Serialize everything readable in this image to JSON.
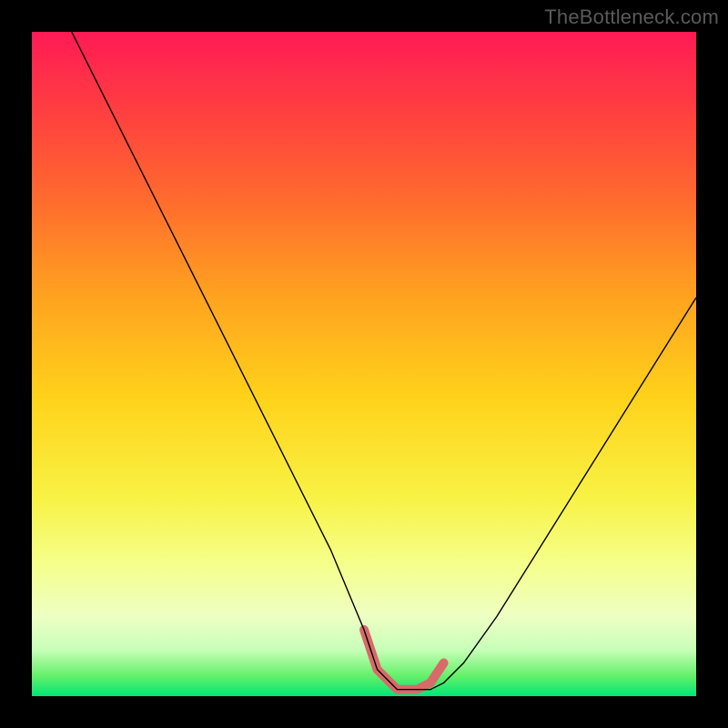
{
  "watermark": {
    "text": "TheBottleneck.com"
  },
  "accent_color": "#d86a6a",
  "curve_color": "#000000",
  "gradient_stops": [
    "#ff1a55",
    "#ff3f40",
    "#ff6a2e",
    "#ffa31f",
    "#ffd21a",
    "#f8f244",
    "#f5ff8a",
    "#eeffc4",
    "#c8ffb8",
    "#63f06a",
    "#00e676"
  ],
  "chart_data": {
    "type": "line",
    "title": "",
    "xlabel": "",
    "ylabel": "",
    "xlim": [
      0,
      100
    ],
    "ylim": [
      0,
      100
    ],
    "grid": false,
    "annotations": [],
    "series": [
      {
        "name": "bottleneck-curve",
        "x": [
          6,
          10,
          15,
          20,
          25,
          30,
          35,
          40,
          45,
          50,
          52,
          55,
          58,
          60,
          62,
          65,
          70,
          75,
          80,
          85,
          90,
          95,
          100
        ],
        "y": [
          100,
          92,
          82,
          72,
          62,
          52,
          42,
          32,
          22,
          10,
          4,
          1,
          1,
          1,
          2,
          5,
          12,
          20,
          28,
          36,
          44,
          52,
          60
        ]
      },
      {
        "name": "optimal-band",
        "x": [
          50,
          52,
          55,
          58,
          60,
          62
        ],
        "y": [
          10,
          4,
          1,
          1,
          2,
          5
        ]
      }
    ]
  }
}
